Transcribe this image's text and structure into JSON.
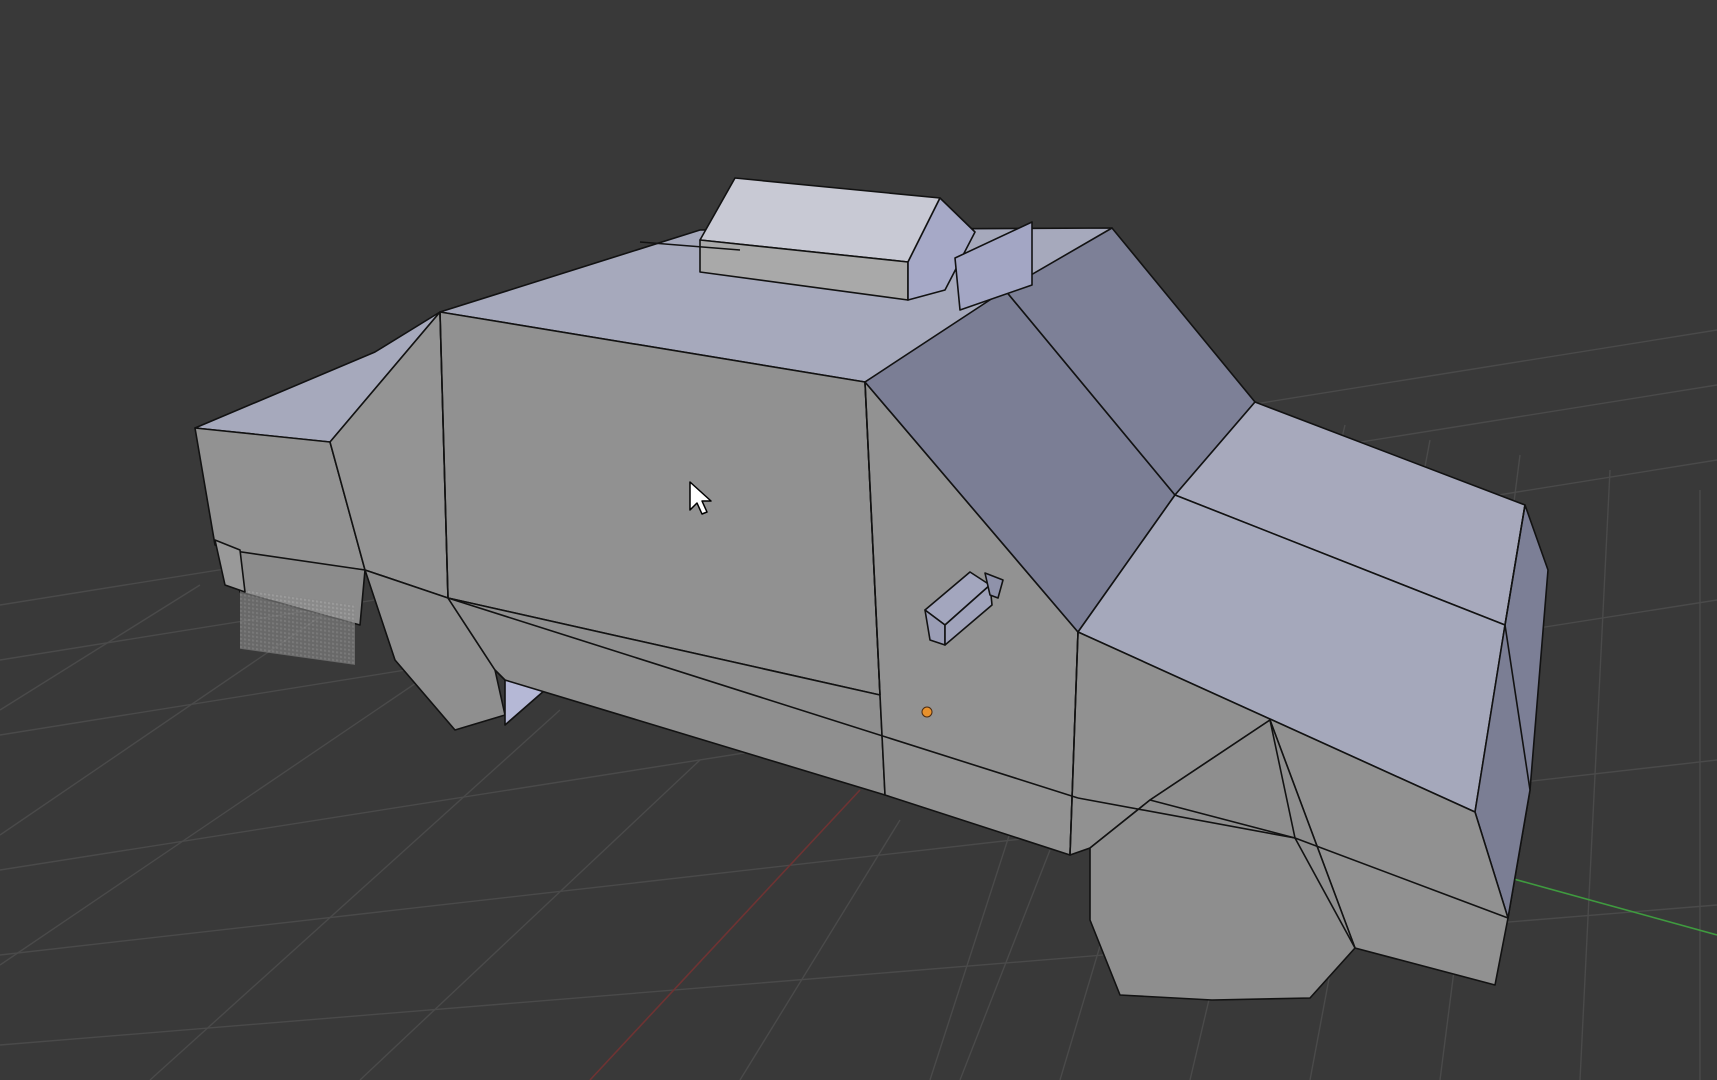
{
  "viewport": {
    "background": "#393939",
    "grid_color": "#494949",
    "x_axis_color": "#7a3434",
    "y_axis_color": "#3f9a3f"
  },
  "model": {
    "edge_color": "#111111",
    "shading": {
      "side": "#929292",
      "top": "#a6a9bc",
      "glass": "#7b7e95",
      "light": "#c8c9d4"
    }
  },
  "origin_marker": {
    "color": "#e8912c"
  },
  "cursor": {
    "icon": "mouse-pointer-icon"
  }
}
